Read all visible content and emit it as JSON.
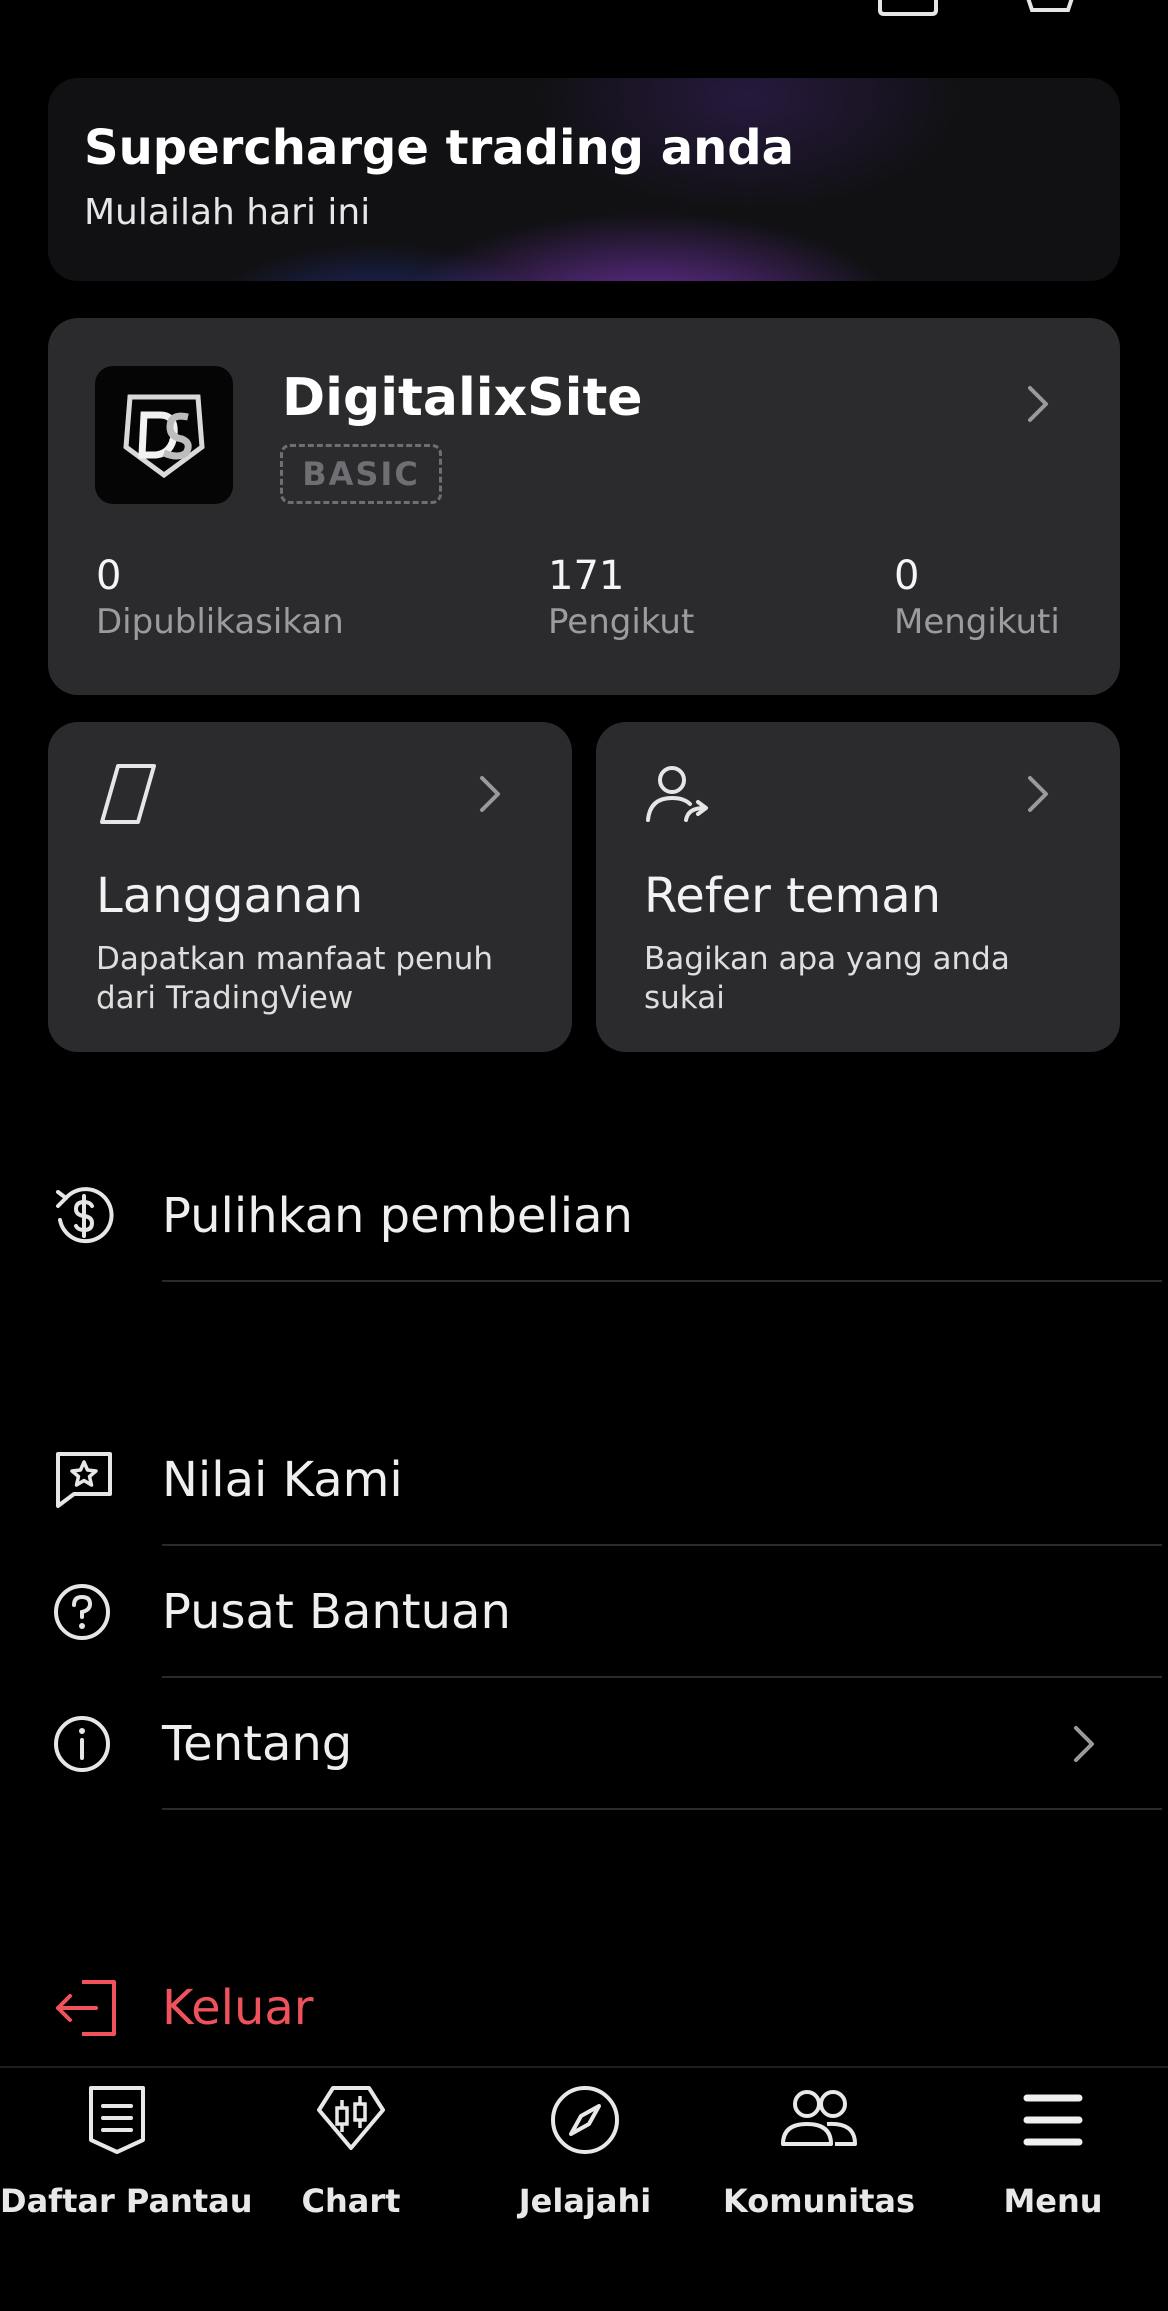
{
  "promo": {
    "title": "Supercharge trading anda",
    "subtitle": "Mulailah hari ini"
  },
  "profile": {
    "username": "DigitalixSite",
    "plan_badge": "BASIC",
    "stats": [
      {
        "value": "0",
        "label": "Dipublikasikan"
      },
      {
        "value": "171",
        "label": "Pengikut"
      },
      {
        "value": "0",
        "label": "Mengikuti"
      }
    ]
  },
  "tiles": [
    {
      "title": "Langganan",
      "desc": "Dapatkan manfaat penuh dari TradingView",
      "icon": "subscription-icon"
    },
    {
      "title": "Refer teman",
      "desc": "Bagikan apa yang anda sukai",
      "icon": "refer-user-icon"
    }
  ],
  "menu": {
    "restore": {
      "label": "Pulihkan pembelian",
      "icon": "dollar-refresh-icon"
    },
    "rate": {
      "label": "Nilai Kami",
      "icon": "star-chat-icon"
    },
    "help": {
      "label": "Pusat Bantuan",
      "icon": "question-icon"
    },
    "about": {
      "label": "Tentang",
      "icon": "info-icon"
    },
    "logout": {
      "label": "Keluar",
      "icon": "logout-icon"
    }
  },
  "nav": [
    {
      "label": "Daftar Pantau",
      "icon": "watchlist-icon"
    },
    {
      "label": "Chart",
      "icon": "chart-icon"
    },
    {
      "label": "Jelajahi",
      "icon": "compass-icon"
    },
    {
      "label": "Komunitas",
      "icon": "community-icon"
    },
    {
      "label": "Menu",
      "icon": "menu-icon"
    }
  ],
  "colors": {
    "background": "#000000",
    "card": "#2b2b2e",
    "logout": "#f0525c",
    "muted": "#9b9ba0"
  }
}
